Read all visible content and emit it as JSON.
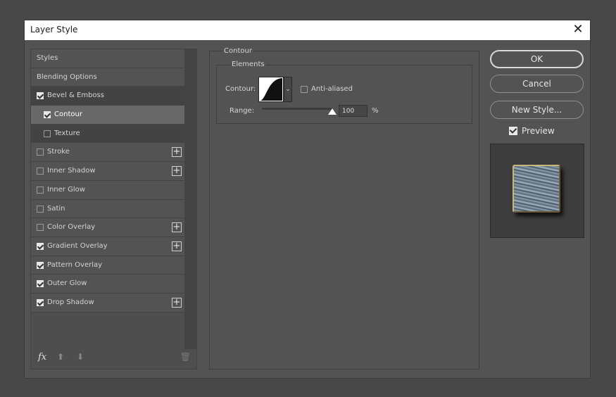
{
  "dialog": {
    "title": "Layer Style",
    "close_glyph": "✕"
  },
  "styles_list": [
    {
      "label": "Styles",
      "kind": "plain",
      "checked": null,
      "plus": false
    },
    {
      "label": "Blending Options",
      "kind": "plain",
      "checked": null,
      "plus": false
    },
    {
      "label": "Bevel & Emboss",
      "kind": "dark",
      "checked": true,
      "plus": false
    },
    {
      "label": "Contour",
      "kind": "sub-selected",
      "checked": true,
      "plus": false
    },
    {
      "label": "Texture",
      "kind": "sub-dark",
      "checked": false,
      "plus": false
    },
    {
      "label": "Stroke",
      "kind": "normal",
      "checked": false,
      "plus": true
    },
    {
      "label": "Inner Shadow",
      "kind": "normal",
      "checked": false,
      "plus": true
    },
    {
      "label": "Inner Glow",
      "kind": "normal",
      "checked": false,
      "plus": false
    },
    {
      "label": "Satin",
      "kind": "normal",
      "checked": false,
      "plus": false
    },
    {
      "label": "Color Overlay",
      "kind": "normal",
      "checked": false,
      "plus": true
    },
    {
      "label": "Gradient Overlay",
      "kind": "normal",
      "checked": true,
      "plus": true
    },
    {
      "label": "Pattern Overlay",
      "kind": "normal",
      "checked": true,
      "plus": false
    },
    {
      "label": "Outer Glow",
      "kind": "normal",
      "checked": true,
      "plus": false
    },
    {
      "label": "Drop Shadow",
      "kind": "normal",
      "checked": true,
      "plus": true
    }
  ],
  "footer": {
    "fx_label": "fx",
    "up_glyph": "⬆",
    "down_glyph": "⬇",
    "trash_glyph": "🗑"
  },
  "contour_panel": {
    "group_label": "Contour",
    "elements_label": "Elements",
    "contour_label": "Contour:",
    "dropdown_glyph": "⌄",
    "anti_aliased_label": "Anti-aliased",
    "anti_aliased_checked": false,
    "range_label": "Range:",
    "range_value": "100",
    "range_percent": 1.0,
    "range_unit": "%"
  },
  "buttons": {
    "ok": "OK",
    "cancel": "Cancel",
    "new_style": "New Style..."
  },
  "preview": {
    "label": "Preview",
    "checked": true
  }
}
